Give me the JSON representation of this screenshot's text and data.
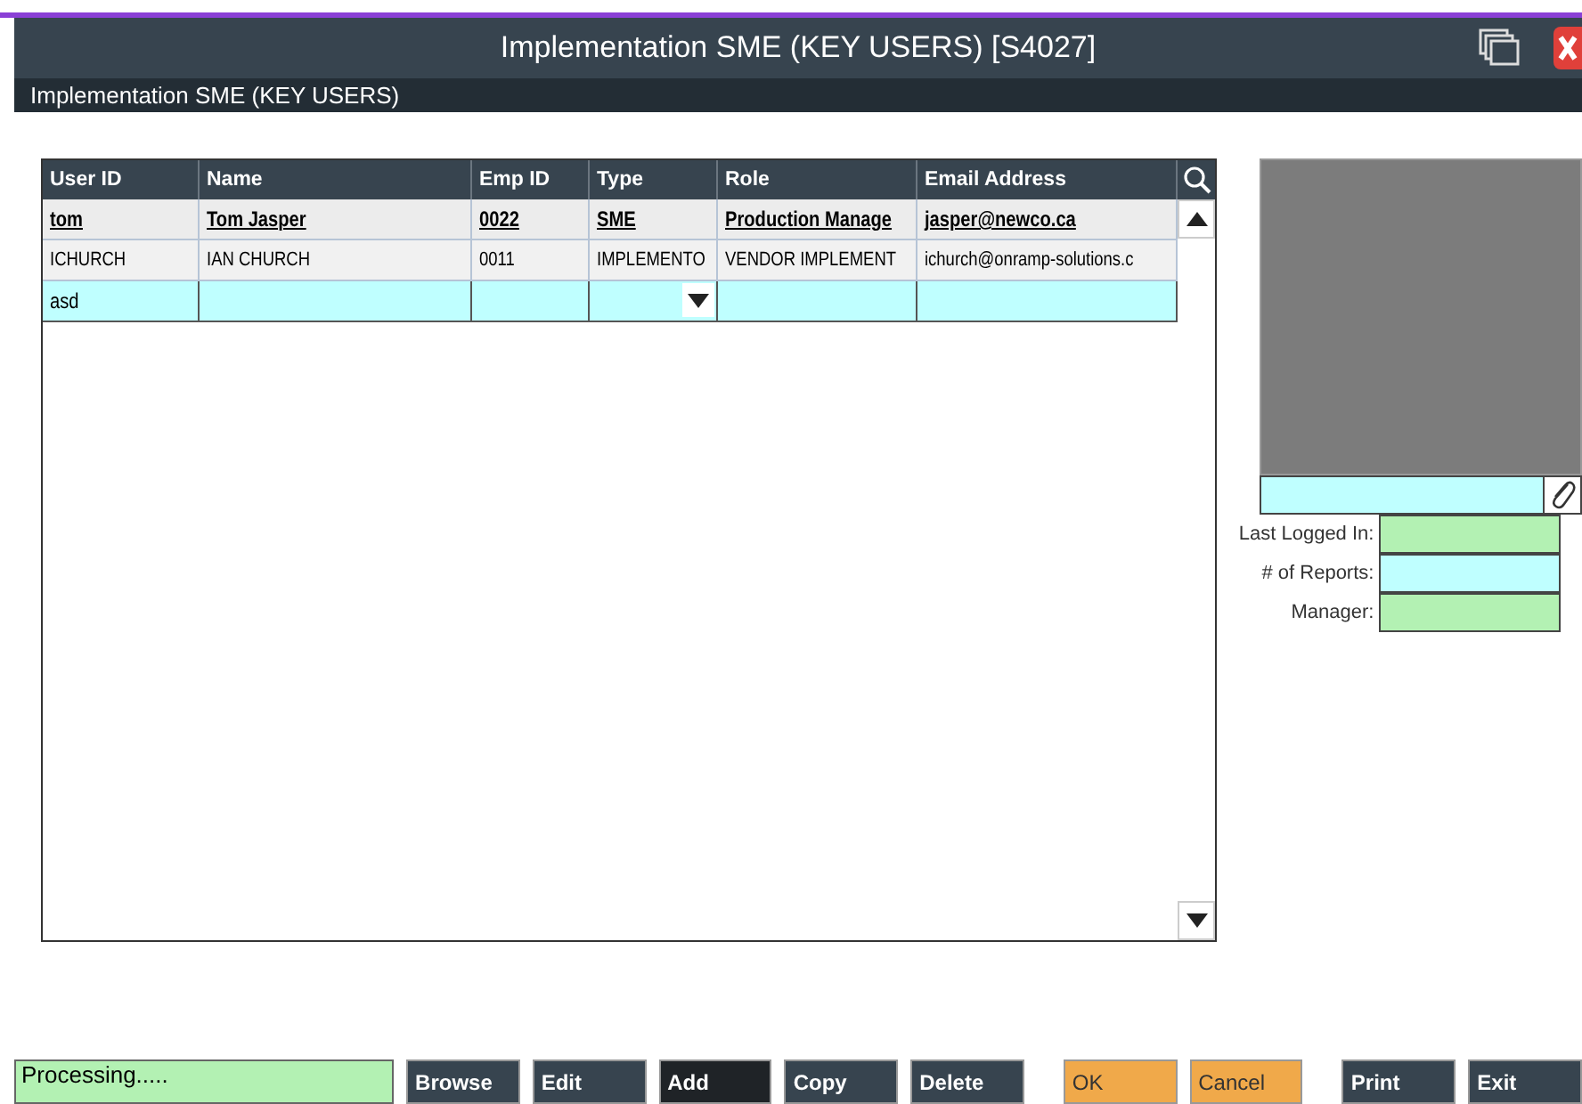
{
  "window": {
    "title": "Implementation SME (KEY USERS) [S4027]"
  },
  "subtitle": "Implementation SME (KEY USERS)",
  "table": {
    "columns": [
      "User ID",
      "Name",
      "Emp ID",
      "Type",
      "Role",
      "Email Address"
    ],
    "rows": [
      {
        "kind": "bold",
        "cells": [
          "tom",
          "Tom Jasper",
          "0022",
          "SME",
          "Production Manage",
          "jasper@newco.ca"
        ]
      },
      {
        "kind": "plain",
        "cells": [
          "ICHURCH",
          "IAN CHURCH",
          "0011",
          "IMPLEMENTO",
          "VENDOR IMPLEMENT",
          "ichurch@onramp-solutions.c"
        ]
      },
      {
        "kind": "new",
        "cells": [
          "asd",
          "",
          "",
          "",
          "",
          ""
        ]
      }
    ]
  },
  "side_fields": [
    {
      "label": "Last Logged In:",
      "color": "#b3f1b3"
    },
    {
      "label": "# of Reports:",
      "color": "#bfffff"
    },
    {
      "label": "Manager:",
      "color": "#b3f1b3"
    }
  ],
  "status": "Processing.....",
  "buttons": [
    {
      "label": "Browse",
      "kind": "normal",
      "selected": false
    },
    {
      "label": "Edit",
      "kind": "normal",
      "selected": false
    },
    {
      "label": "Add",
      "kind": "normal",
      "selected": true
    },
    {
      "label": "Copy",
      "kind": "normal",
      "selected": false
    },
    {
      "label": "Delete",
      "kind": "normal",
      "selected": false
    },
    {
      "label": "OK",
      "kind": "accent",
      "selected": false
    },
    {
      "label": "Cancel",
      "kind": "accent",
      "selected": false
    },
    {
      "label": "Print",
      "kind": "normal",
      "selected": false
    },
    {
      "label": "Exit",
      "kind": "normal",
      "selected": false
    }
  ]
}
